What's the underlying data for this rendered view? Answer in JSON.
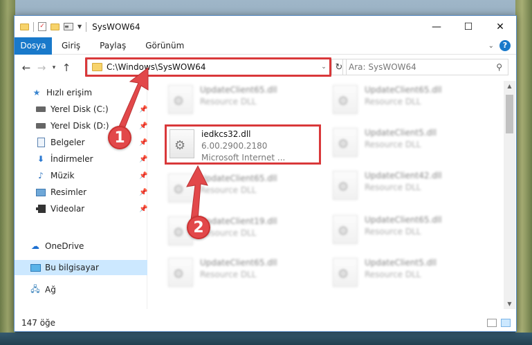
{
  "window": {
    "title": "SysWOW64",
    "controls": {
      "minimize": "—",
      "maximize": "☐",
      "close": "✕"
    }
  },
  "ribbon": {
    "file_tab": "Dosya",
    "tabs": [
      "Giriş",
      "Paylaş",
      "Görünüm"
    ],
    "help": "?"
  },
  "nav": {
    "address": "C:\\Windows\\SysWOW64",
    "search_placeholder": "Ara: SysWOW64"
  },
  "sidebar": {
    "items": [
      {
        "label": "Hızlı erişim",
        "icon": "star-icon"
      },
      {
        "label": "Yerel Disk (C:)",
        "icon": "drive-icon",
        "pinned": true
      },
      {
        "label": "Yerel Disk (D:)",
        "icon": "drive-icon",
        "pinned": true
      },
      {
        "label": "Belgeler",
        "icon": "document-icon",
        "pinned": true
      },
      {
        "label": "İndirmeler",
        "icon": "download-icon",
        "pinned": true
      },
      {
        "label": "Müzik",
        "icon": "music-icon",
        "pinned": true
      },
      {
        "label": "Resimler",
        "icon": "pictures-icon",
        "pinned": true
      },
      {
        "label": "Videolar",
        "icon": "video-icon",
        "pinned": true
      },
      {
        "label": "OneDrive",
        "icon": "cloud-icon"
      },
      {
        "label": "Bu bilgisayar",
        "icon": "computer-icon",
        "selected": true
      },
      {
        "label": "Ağ",
        "icon": "network-icon"
      }
    ]
  },
  "files": {
    "left": [
      {
        "name": "UpdateClient65.dll",
        "sub": "Resource DLL"
      },
      {
        "name": "UpdateClient65.dll",
        "sub": "Resource DLL"
      },
      {
        "name": "UpdateClient19.dll",
        "sub": "Resource DLL"
      },
      {
        "name": "UpdateClient65.dll",
        "sub": "Resource DLL"
      }
    ],
    "right": [
      {
        "name": "UpdateClient65.dll",
        "sub": "Resource DLL"
      },
      {
        "name": "UpdateClient5.dll",
        "sub": "Resource DLL"
      },
      {
        "name": "UpdateClient42.dll",
        "sub": "Resource DLL"
      },
      {
        "name": "UpdateClient65.dll",
        "sub": "Resource DLL"
      },
      {
        "name": "UpdateClient5.dll",
        "sub": "Resource DLL"
      }
    ],
    "highlighted": {
      "name": "iedkcs32.dll",
      "version": "6.00.2900.2180",
      "company": "Microsoft Internet ..."
    }
  },
  "status": {
    "count": "147 öğe"
  },
  "markers": {
    "one": "1",
    "two": "2"
  },
  "colors": {
    "accent": "#1979ca",
    "highlight": "#d9383a"
  }
}
